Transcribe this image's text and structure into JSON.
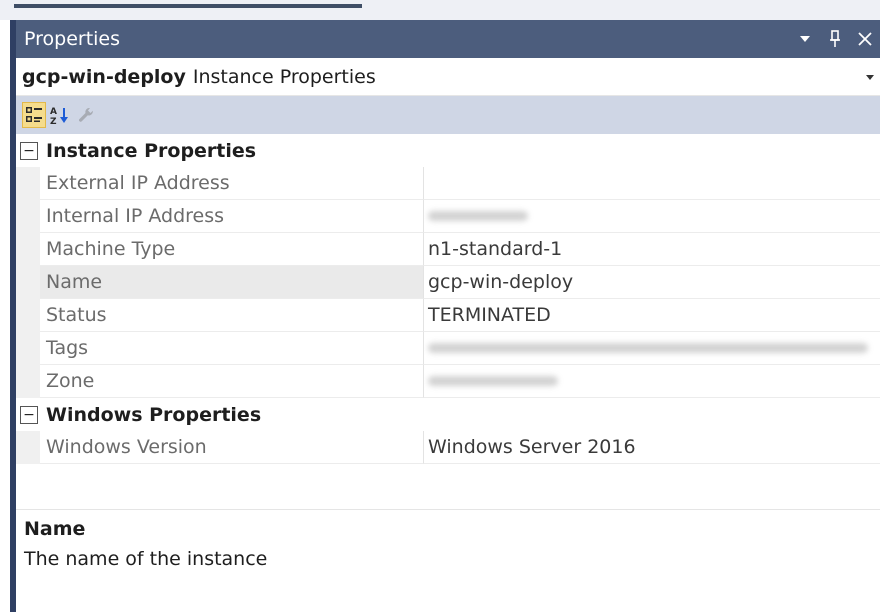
{
  "window": {
    "title": "Properties",
    "controls": [
      "dropdown-arrow-icon",
      "pin-icon",
      "close-icon"
    ]
  },
  "object_selector": {
    "name": "gcp-win-deploy",
    "type": "Instance Properties"
  },
  "toolbar": {
    "buttons": [
      {
        "icon": "categorized-icon",
        "active": true
      },
      {
        "icon": "alphabetical-sort-icon",
        "active": false
      },
      {
        "icon": "property-pages-wrench-icon",
        "disabled": true
      }
    ]
  },
  "categories": [
    {
      "label": "Instance Properties",
      "expanded": true,
      "properties": [
        {
          "name": "External IP Address",
          "value": ""
        },
        {
          "name": "Internal IP Address",
          "value": "",
          "redacted": true
        },
        {
          "name": "Machine Type",
          "value": "n1-standard-1"
        },
        {
          "name": "Name",
          "value": "gcp-win-deploy",
          "selected": true
        },
        {
          "name": "Status",
          "value": "TERMINATED"
        },
        {
          "name": "Tags",
          "value": "",
          "redacted": true
        },
        {
          "name": "Zone",
          "value": "",
          "redacted": true
        }
      ]
    },
    {
      "label": "Windows Properties",
      "expanded": true,
      "properties": [
        {
          "name": "Windows Version",
          "value": "Windows Server 2016"
        }
      ]
    }
  ],
  "description": {
    "title": "Name",
    "text": "The name of the instance"
  },
  "colors": {
    "titlebar": "#4c5d7d",
    "toolbar": "#cfd6e5",
    "active_button": "#f5dc8c",
    "panel_border": "#2f3f63"
  }
}
